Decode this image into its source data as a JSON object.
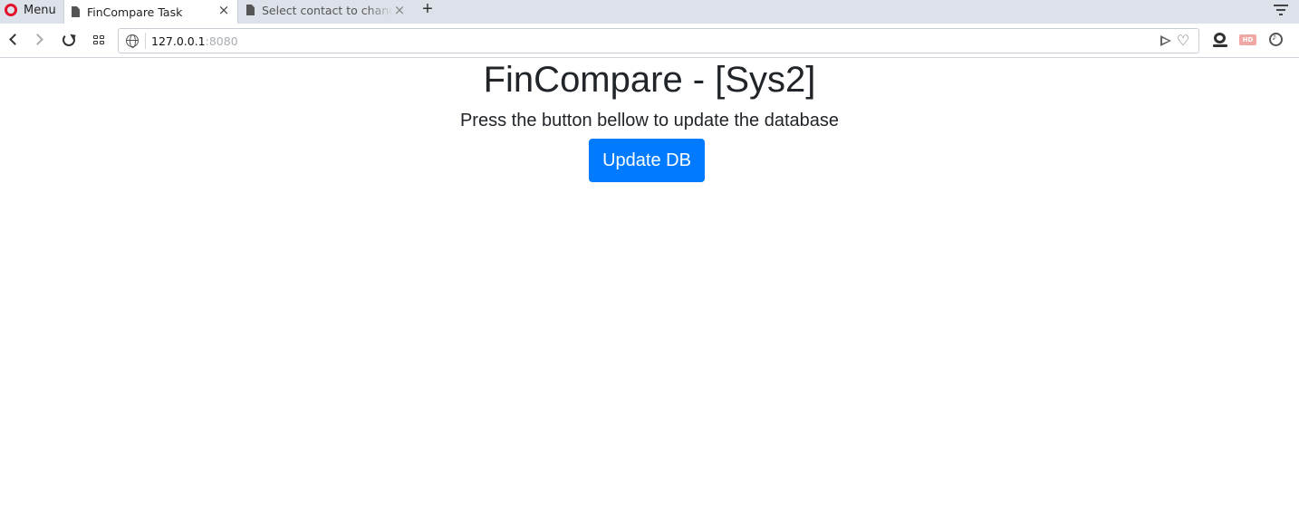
{
  "browser": {
    "menu_label": "Menu",
    "tabs": [
      {
        "title": "FinCompare Task",
        "active": true
      },
      {
        "title": "Select contact to change",
        "active": false
      }
    ],
    "close_glyph": "×",
    "new_tab_glyph": "+",
    "url": {
      "host": "127.0.0.1",
      "port": ":8080"
    },
    "icons": {
      "logo": "opera-logo-icon",
      "tab": "document-icon",
      "back": "chevron-left-icon",
      "forward": "chevron-right-icon",
      "reload": "reload-icon",
      "speed_dial": "grid-icon",
      "site_info": "globe-icon",
      "send": "send-icon",
      "bookmark": "heart-icon",
      "extensions": [
        "webcam-icon",
        "hd-icon",
        "music-icon"
      ],
      "tab_menu": "tab-menu-icon"
    },
    "hd_badge": "HD",
    "heart_glyph": "♡",
    "colors": {
      "opera_red": "#e3122b",
      "tabbar_bg": "#dde2ea"
    }
  },
  "page": {
    "title": "FinCompare - [Sys2]",
    "subtitle": "Press the button bellow to update the database",
    "button_label": "Update DB",
    "colors": {
      "button_bg": "#007bff",
      "button_text": "#ffffff",
      "text": "#212529"
    }
  }
}
